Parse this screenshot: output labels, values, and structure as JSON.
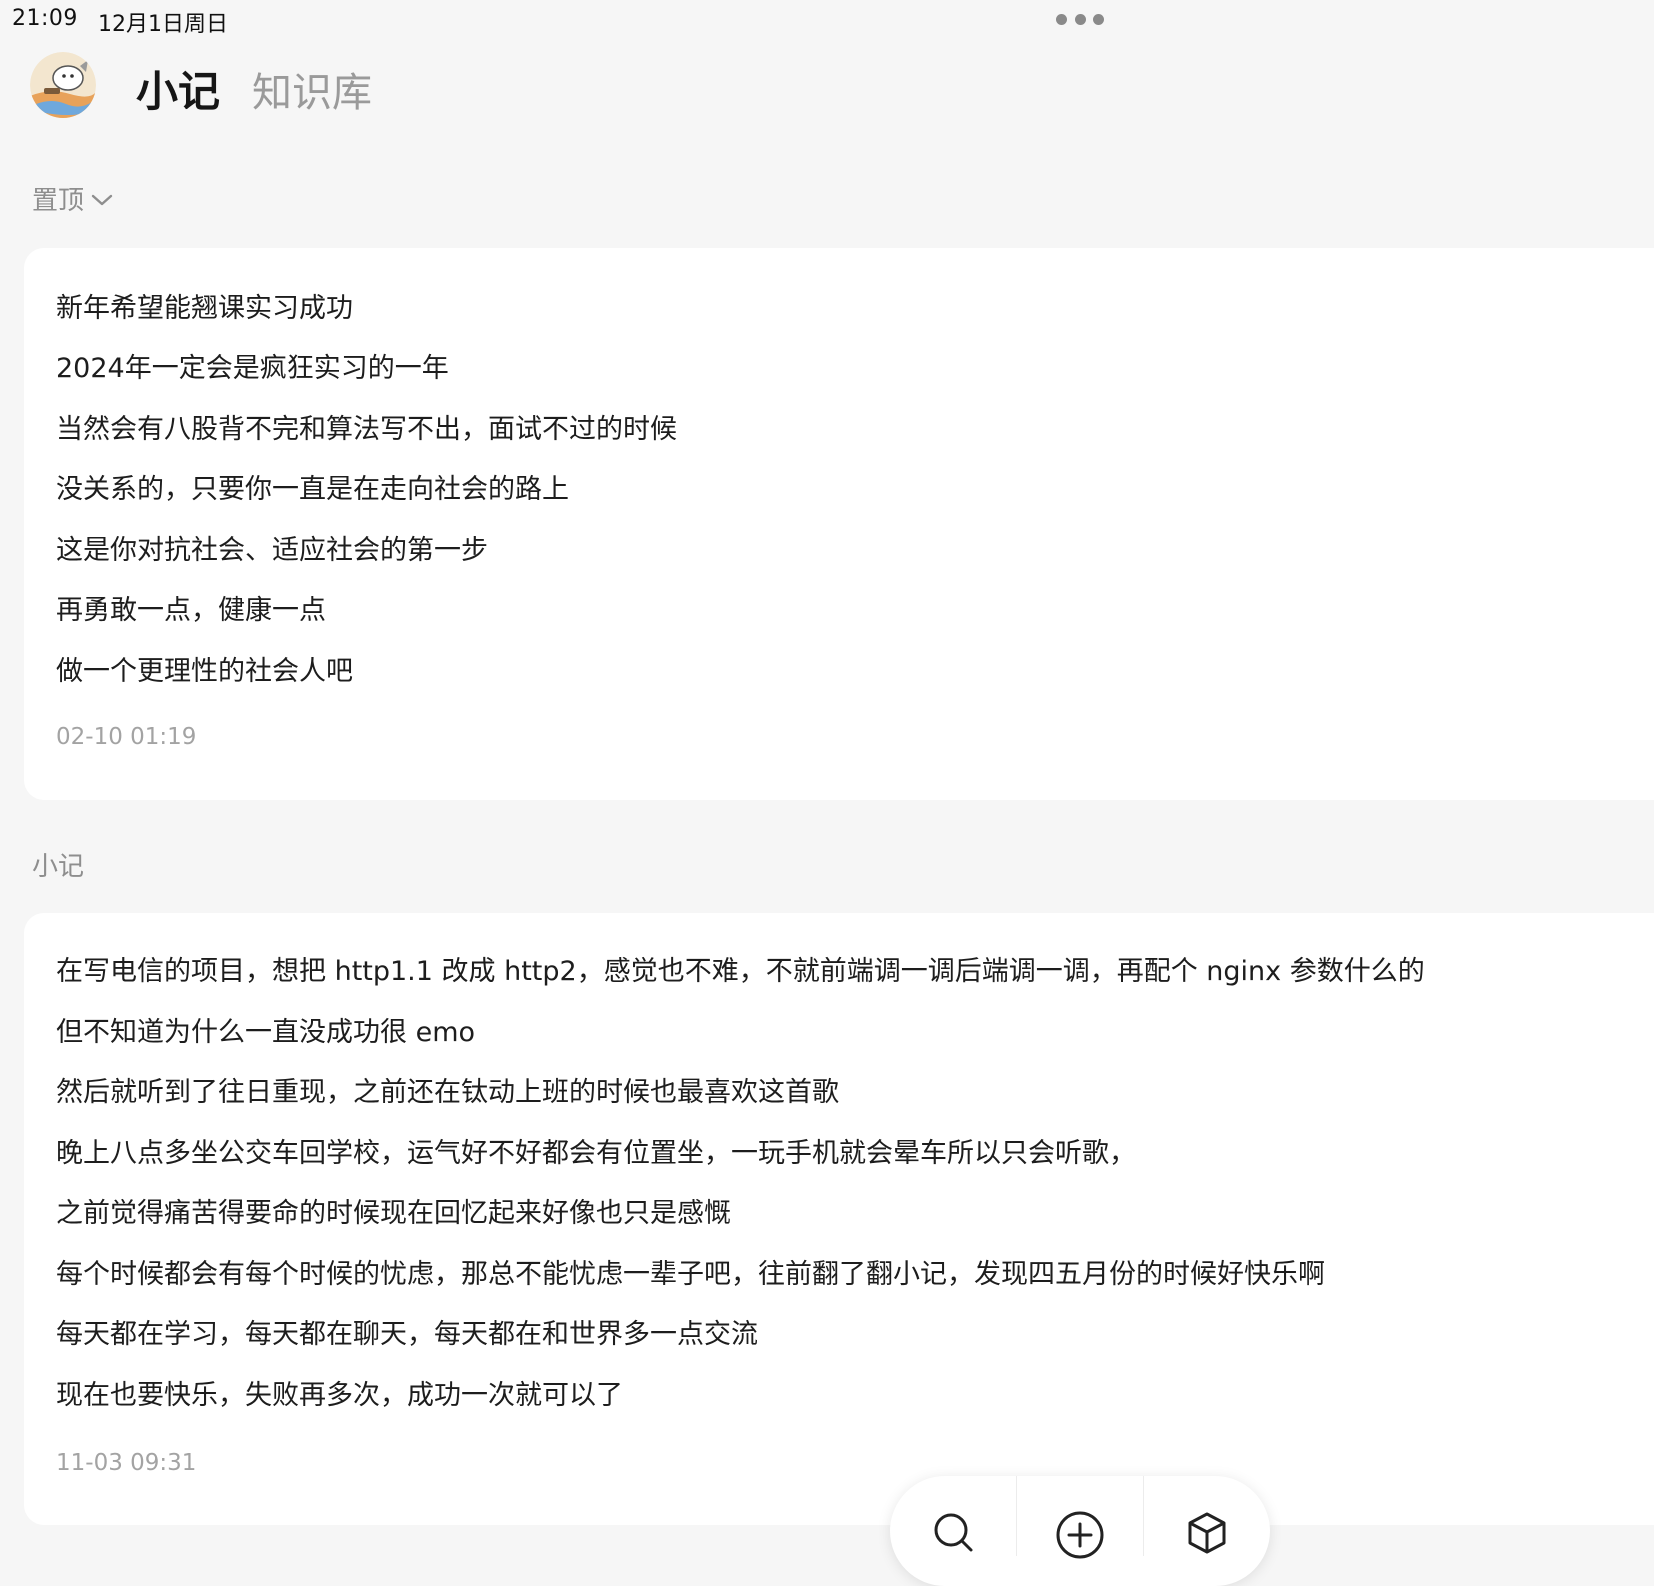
{
  "status_bar": {
    "time": "21:09",
    "date": "12月1日周日"
  },
  "header": {
    "tabs": [
      {
        "label": "小记",
        "active": true
      },
      {
        "label": "知识库",
        "active": false
      }
    ]
  },
  "pinned": {
    "label": "置顶",
    "note": {
      "lines": [
        "新年希望能翘课实习成功",
        "2024年一定会是疯狂实习的一年",
        "当然会有八股背不完和算法写不出，面试不过的时候",
        "没关系的，只要你一直是在走向社会的路上",
        "这是你对抗社会、适应社会的第一步",
        "再勇敢一点，健康一点",
        "做一个更理性的社会人吧"
      ],
      "timestamp": "02-10 01:19"
    }
  },
  "notes": {
    "label": "小记",
    "items": [
      {
        "lines": [
          "在写电信的项目，想把 http1.1 改成 http2，感觉也不难，不就前端调一调后端调一调，再配个 nginx 参数什么的",
          "但不知道为什么一直没成功很 emo",
          "然后就听到了往日重现，之前还在钛动上班的时候也最喜欢这首歌",
          "晚上八点多坐公交车回学校，运气好不好都会有位置坐，一玩手机就会晕车所以只会听歌，",
          "之前觉得痛苦得要命的时候现在回忆起来好像也只是感慨",
          "每个时候都会有每个时候的忧虑，那总不能忧虑一辈子吧，往前翻了翻小记，发现四五月份的时候好快乐啊",
          "每天都在学习，每天都在聊天，每天都在和世界多一点交流",
          "现在也要快乐，失败再多次，成功一次就可以了"
        ],
        "timestamp": "11-03 09:31"
      }
    ]
  },
  "toolbar": {
    "icons": [
      "search-icon",
      "add-circle-icon",
      "cube-icon"
    ]
  },
  "colors": {
    "background": "#f6f6f6",
    "card": "#ffffff",
    "muted_text": "#8e8e8e",
    "timestamp_text": "#a3a3a3"
  }
}
